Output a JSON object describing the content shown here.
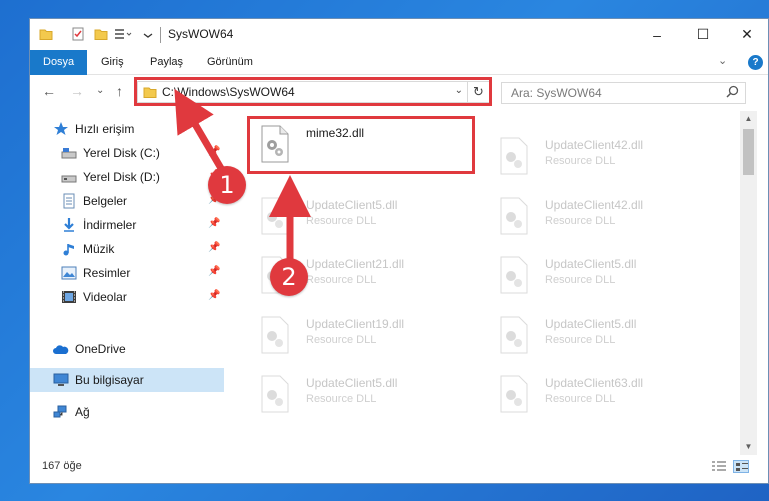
{
  "window": {
    "title": "SysWOW64",
    "minimize": "–",
    "maximize": "☐",
    "close": "✕"
  },
  "ribbon": {
    "tabs": [
      {
        "label": "Dosya",
        "active": true
      },
      {
        "label": "Giriş",
        "active": false
      },
      {
        "label": "Paylaş",
        "active": false
      },
      {
        "label": "Görünüm",
        "active": false
      }
    ],
    "expand": "⌄",
    "help": "?"
  },
  "nav": {
    "back": "←",
    "forward": "→",
    "recent": "⌄",
    "up": "↑",
    "address": "C:\\Windows\\SysWOW64",
    "address_dropdown": "⌄",
    "refresh": "↻",
    "search_placeholder": "Ara: SysWOW64"
  },
  "sidebar": {
    "items": [
      {
        "label": "Hızlı erişim",
        "icon": "star-icon",
        "pinned": false
      },
      {
        "label": "Yerel Disk (C:)",
        "icon": "drive-icon",
        "pinned": true
      },
      {
        "label": "Yerel Disk (D:)",
        "icon": "drive-icon",
        "pinned": true
      },
      {
        "label": "Belgeler",
        "icon": "document-icon",
        "pinned": true
      },
      {
        "label": "İndirmeler",
        "icon": "download-icon",
        "pinned": true
      },
      {
        "label": "Müzik",
        "icon": "music-icon",
        "pinned": true
      },
      {
        "label": "Resimler",
        "icon": "picture-icon",
        "pinned": true
      },
      {
        "label": "Videolar",
        "icon": "video-icon",
        "pinned": true
      },
      {
        "label": "OneDrive",
        "icon": "cloud-icon",
        "pinned": false
      },
      {
        "label": "Bu bilgisayar",
        "icon": "computer-icon",
        "pinned": false,
        "selected": true
      },
      {
        "label": "Ağ",
        "icon": "network-icon",
        "pinned": false
      }
    ]
  },
  "files": {
    "left": [
      {
        "name": "mime32.dll",
        "desc": ""
      },
      {
        "name": "UpdateClient5.dll",
        "desc": "Resource DLL"
      },
      {
        "name": "UpdateClient21.dll",
        "desc": "Resource DLL"
      },
      {
        "name": "UpdateClient19.dll",
        "desc": "Resource DLL"
      },
      {
        "name": "UpdateClient5.dll",
        "desc": "Resource DLL"
      }
    ],
    "right": [
      {
        "name": "UpdateClient42.dll",
        "desc": "Resource DLL"
      },
      {
        "name": "UpdateClient42.dll",
        "desc": "Resource DLL"
      },
      {
        "name": "UpdateClient5.dll",
        "desc": "Resource DLL"
      },
      {
        "name": "UpdateClient5.dll",
        "desc": "Resource DLL"
      },
      {
        "name": "UpdateClient63.dll",
        "desc": "Resource DLL"
      }
    ]
  },
  "status": {
    "count": "167 öğe"
  },
  "annotations": {
    "badge1": "1",
    "badge2": "2",
    "color": "#e0393e"
  }
}
